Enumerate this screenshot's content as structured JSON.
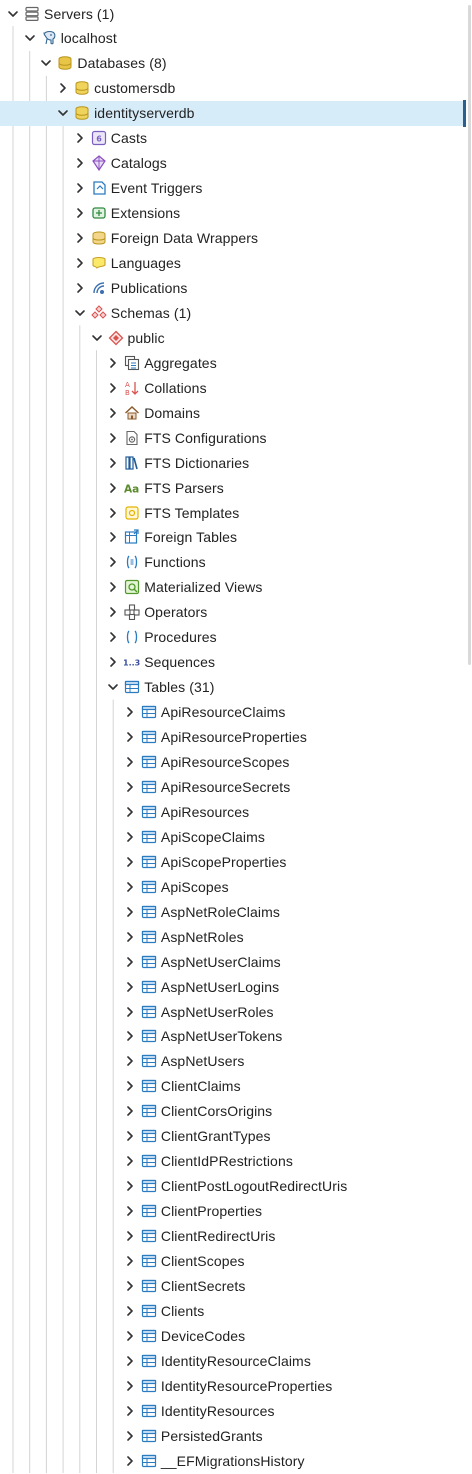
{
  "tree": {
    "servers": "Servers (1)",
    "localhost": "localhost",
    "databases": "Databases (8)",
    "customersdb": "customersdb",
    "identityserverdb": "identityserverdb",
    "db_children": [
      "Casts",
      "Catalogs",
      "Event Triggers",
      "Extensions",
      "Foreign Data Wrappers",
      "Languages",
      "Publications"
    ],
    "schemas": "Schemas (1)",
    "public": "public",
    "schema_children": [
      "Aggregates",
      "Collations",
      "Domains",
      "FTS Configurations",
      "FTS Dictionaries",
      "FTS Parsers",
      "FTS Templates",
      "Foreign Tables",
      "Functions",
      "Materialized Views",
      "Operators",
      "Procedures",
      "Sequences"
    ],
    "tables": "Tables (31)",
    "table_items": [
      "ApiResourceClaims",
      "ApiResourceProperties",
      "ApiResourceScopes",
      "ApiResourceSecrets",
      "ApiResources",
      "ApiScopeClaims",
      "ApiScopeProperties",
      "ApiScopes",
      "AspNetRoleClaims",
      "AspNetRoles",
      "AspNetUserClaims",
      "AspNetUserLogins",
      "AspNetUserRoles",
      "AspNetUserTokens",
      "AspNetUsers",
      "ClientClaims",
      "ClientCorsOrigins",
      "ClientGrantTypes",
      "ClientIdPRestrictions",
      "ClientPostLogoutRedirectUris",
      "ClientProperties",
      "ClientRedirectUris",
      "ClientScopes",
      "ClientSecrets",
      "Clients",
      "DeviceCodes",
      "IdentityResourceClaims",
      "IdentityResourceProperties",
      "IdentityResources",
      "PersistedGrants",
      "__EFMigrationsHistory"
    ]
  },
  "icons": {
    "db_children": [
      "cast-icon",
      "catalog-icon",
      "event-trigger-icon",
      "extension-icon",
      "foreign-data-wrapper-icon",
      "language-icon",
      "publication-icon"
    ],
    "schema_children": [
      "aggregate-icon",
      "collation-icon",
      "domain-icon",
      "fts-configuration-icon",
      "fts-dictionary-icon",
      "fts-parser-icon",
      "fts-template-icon",
      "foreign-table-icon",
      "function-icon",
      "materialized-view-icon",
      "operator-icon",
      "procedure-icon",
      "sequence-icon"
    ]
  },
  "colors": {
    "selected_background": "#d7ecf9",
    "selected_marker": "#2b5f8c",
    "database_gold": "#c9a227",
    "table_blue": "#2a7bc0",
    "schema_red": "#d9534f"
  }
}
